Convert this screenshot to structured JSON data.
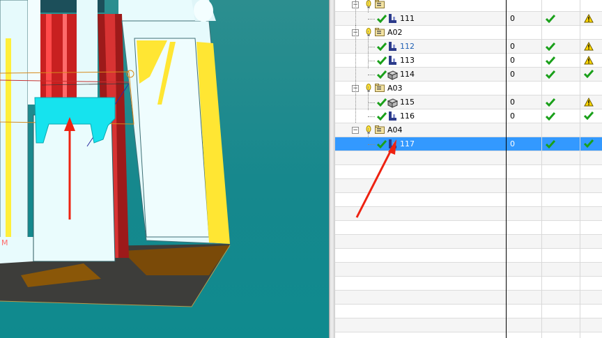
{
  "viewport": {
    "overlay_text": "M"
  },
  "tree": {
    "columns": [
      "",
      "",
      "",
      ""
    ],
    "rows": [
      {
        "kind": "group-partial",
        "label": ""
      },
      {
        "kind": "part",
        "label": "111",
        "value": "0",
        "status1": "check",
        "status2": "warning",
        "icon": "fixture-icon"
      },
      {
        "kind": "group",
        "label": "A02"
      },
      {
        "kind": "part",
        "label": "112",
        "value": "0",
        "status1": "check",
        "status2": "warning",
        "icon": "fixture-icon",
        "highlight": true
      },
      {
        "kind": "part",
        "label": "113",
        "value": "0",
        "status1": "check",
        "status2": "warning",
        "icon": "fixture-icon"
      },
      {
        "kind": "part",
        "label": "114",
        "value": "0",
        "status1": "check",
        "status2": "check",
        "icon": "block-icon"
      },
      {
        "kind": "group",
        "label": "A03"
      },
      {
        "kind": "part",
        "label": "115",
        "value": "0",
        "status1": "check",
        "status2": "warning",
        "icon": "block-icon"
      },
      {
        "kind": "part",
        "label": "116",
        "value": "0",
        "status1": "check",
        "status2": "check",
        "icon": "fixture-icon"
      },
      {
        "kind": "group",
        "label": "A04"
      },
      {
        "kind": "part",
        "label": "117",
        "value": "0",
        "status1": "check",
        "status2": "check",
        "icon": "fixture-icon",
        "selected": true
      }
    ]
  },
  "colors": {
    "selection": "#3399ff",
    "accent_yellow": "#ffe633",
    "cyan_part": "#00e5ee",
    "red_part": "#cc2222",
    "arrow": "#ee2211"
  }
}
